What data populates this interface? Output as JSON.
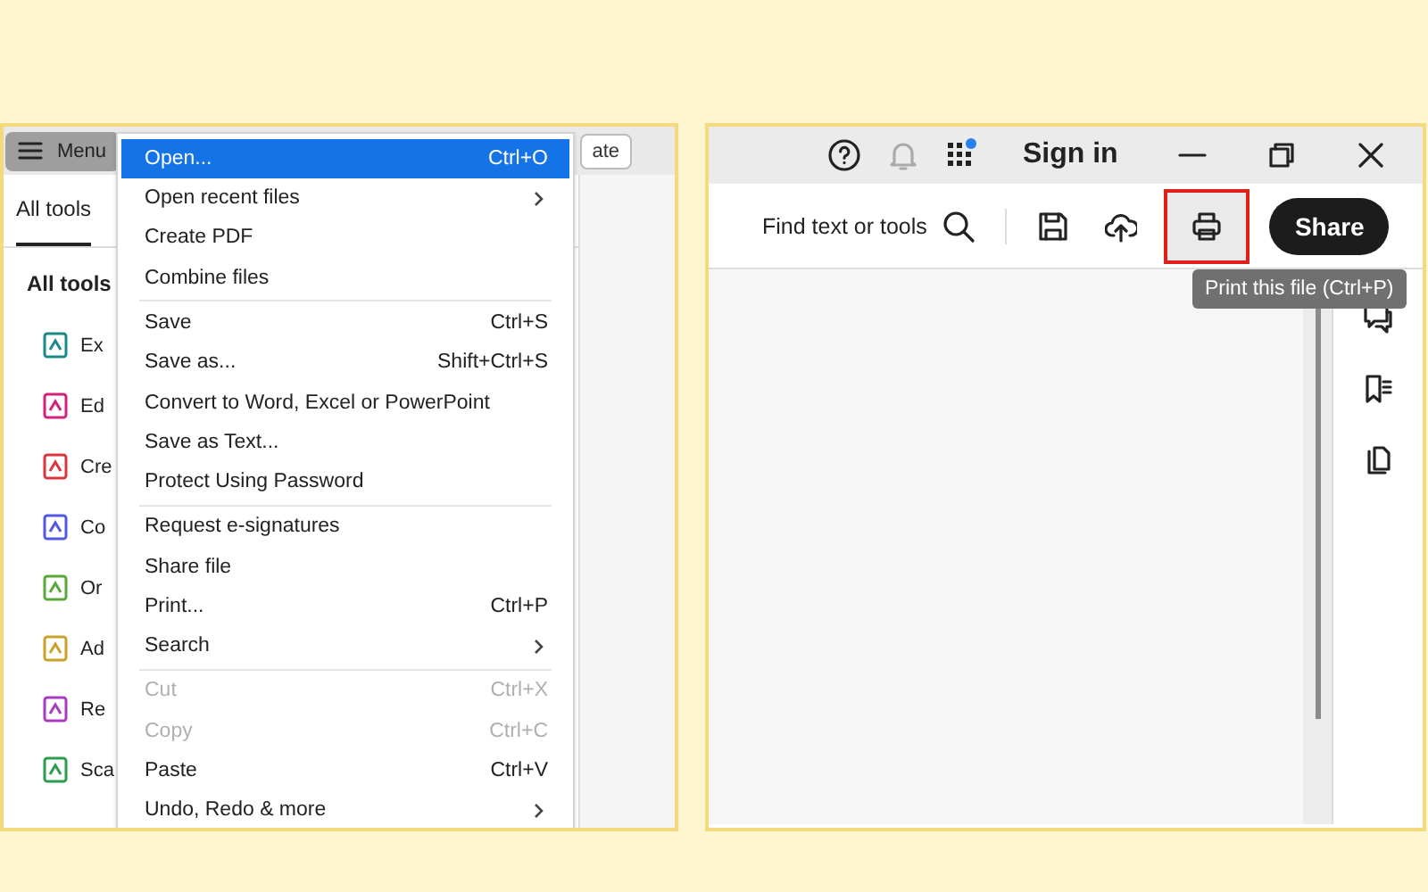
{
  "left_window": {
    "menu_button": "Menu",
    "top_button": "ate",
    "tabs": [
      {
        "label": "All tools",
        "selected": true
      }
    ],
    "heading": "All tools",
    "tools": [
      {
        "label": "Ex",
        "color": "#1a8a86"
      },
      {
        "label": "Ed",
        "color": "#d1237a"
      },
      {
        "label": "Cre",
        "color": "#d9363e"
      },
      {
        "label": "Co",
        "color": "#5258e4"
      },
      {
        "label": "Or",
        "color": "#5aa83a"
      },
      {
        "label": "Ad",
        "color": "#c9a22a"
      },
      {
        "label": "Re",
        "color": "#a93bc1"
      },
      {
        "label": "Sca",
        "color": "#2d9d4e"
      }
    ],
    "menu": {
      "groups": [
        [
          {
            "label": "Open...",
            "shortcut": "Ctrl+O",
            "selected": true,
            "disabled": false,
            "submenu": false
          },
          {
            "label": "Open recent files",
            "selected": false,
            "disabled": false,
            "submenu": true
          },
          {
            "label": "Create PDF",
            "selected": false,
            "disabled": false,
            "submenu": false
          },
          {
            "label": "Combine files",
            "selected": false,
            "disabled": false,
            "submenu": false
          }
        ],
        [
          {
            "label": "Save",
            "shortcut": "Ctrl+S",
            "selected": false,
            "disabled": false,
            "submenu": false
          },
          {
            "label": "Save as...",
            "shortcut": "Shift+Ctrl+S",
            "selected": false,
            "disabled": false,
            "submenu": false
          },
          {
            "label": "Convert to Word, Excel or PowerPoint",
            "selected": false,
            "disabled": false,
            "submenu": false
          },
          {
            "label": "Save as Text...",
            "selected": false,
            "disabled": false,
            "submenu": false
          },
          {
            "label": "Protect Using Password",
            "selected": false,
            "disabled": false,
            "submenu": false
          }
        ],
        [
          {
            "label": "Request e-signatures",
            "selected": false,
            "disabled": false,
            "submenu": false
          },
          {
            "label": "Share file",
            "selected": false,
            "disabled": false,
            "submenu": false
          },
          {
            "label": "Print...",
            "shortcut": "Ctrl+P",
            "selected": false,
            "disabled": false,
            "submenu": false
          },
          {
            "label": "Search",
            "selected": false,
            "disabled": false,
            "submenu": true
          }
        ],
        [
          {
            "label": "Cut",
            "shortcut": "Ctrl+X",
            "selected": false,
            "disabled": true,
            "submenu": false
          },
          {
            "label": "Copy",
            "shortcut": "Ctrl+C",
            "selected": false,
            "disabled": true,
            "submenu": false
          },
          {
            "label": "Paste",
            "shortcut": "Ctrl+V",
            "selected": false,
            "disabled": false,
            "submenu": false
          },
          {
            "label": "Undo, Redo & more",
            "selected": false,
            "disabled": false,
            "submenu": true
          }
        ]
      ]
    }
  },
  "right_window": {
    "sign_in": "Sign in",
    "find_label": "Find text or tools",
    "toolbar_buttons": [
      {
        "kind": "save",
        "highlighted": false
      },
      {
        "kind": "upload",
        "highlighted": false
      },
      {
        "kind": "print",
        "highlighted": true
      }
    ],
    "share_button": "Share",
    "tooltip": "Print this file (Ctrl+P)",
    "sidebar_buttons": [
      {
        "kind": "comment"
      },
      {
        "kind": "bookmarks"
      },
      {
        "kind": "pages"
      }
    ]
  }
}
